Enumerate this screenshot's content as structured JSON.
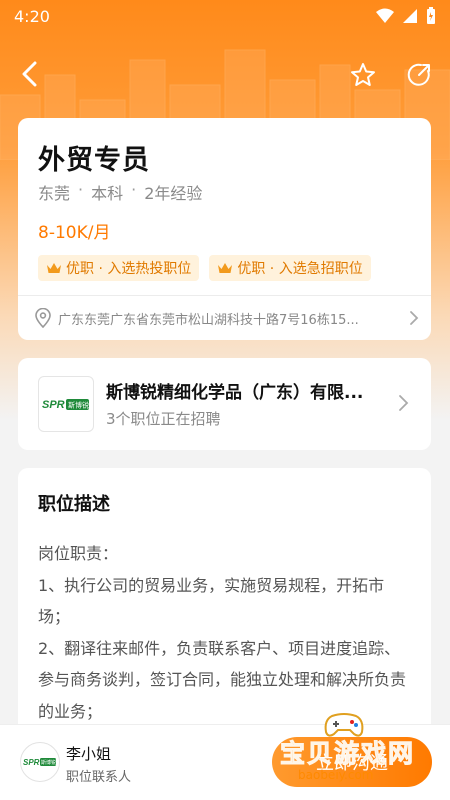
{
  "status_bar": {
    "time": "4:20"
  },
  "job": {
    "title": "外贸专员",
    "location": "东莞",
    "education": "本科",
    "experience": "2年经验",
    "separator": "·",
    "salary": "8-10K/月",
    "tags": [
      "优职 · 入选热投职位",
      "优职 · 入选急招职位"
    ],
    "address": "广东东莞广东省东莞市松山湖科技十路7号16栋15..."
  },
  "company": {
    "logo_text": "SPR",
    "logo_sub": "斯博锐",
    "name": "斯博锐精细化学品（广东）有限...",
    "positions": "3个职位正在招聘"
  },
  "description": {
    "title": "职位描述",
    "lines": [
      "岗位职责：",
      "1、执行公司的贸易业务，实施贸易规程，开拓市场；",
      "2、翻译往来邮件，负责联系客户、项目进度追踪、参与商务谈判，签订合同，能独立处理和解决所负责的业务；"
    ]
  },
  "contact": {
    "name": "李小姐",
    "role": "职位联系人"
  },
  "apply": {
    "label": "立即沟通"
  },
  "watermark": {
    "text": "宝贝游戏网",
    "url": "baobeiy.com"
  },
  "colors": {
    "accent": "#ff7a00",
    "tag_bg": "#fff2dc",
    "logo_green": "#1f8a3a"
  }
}
